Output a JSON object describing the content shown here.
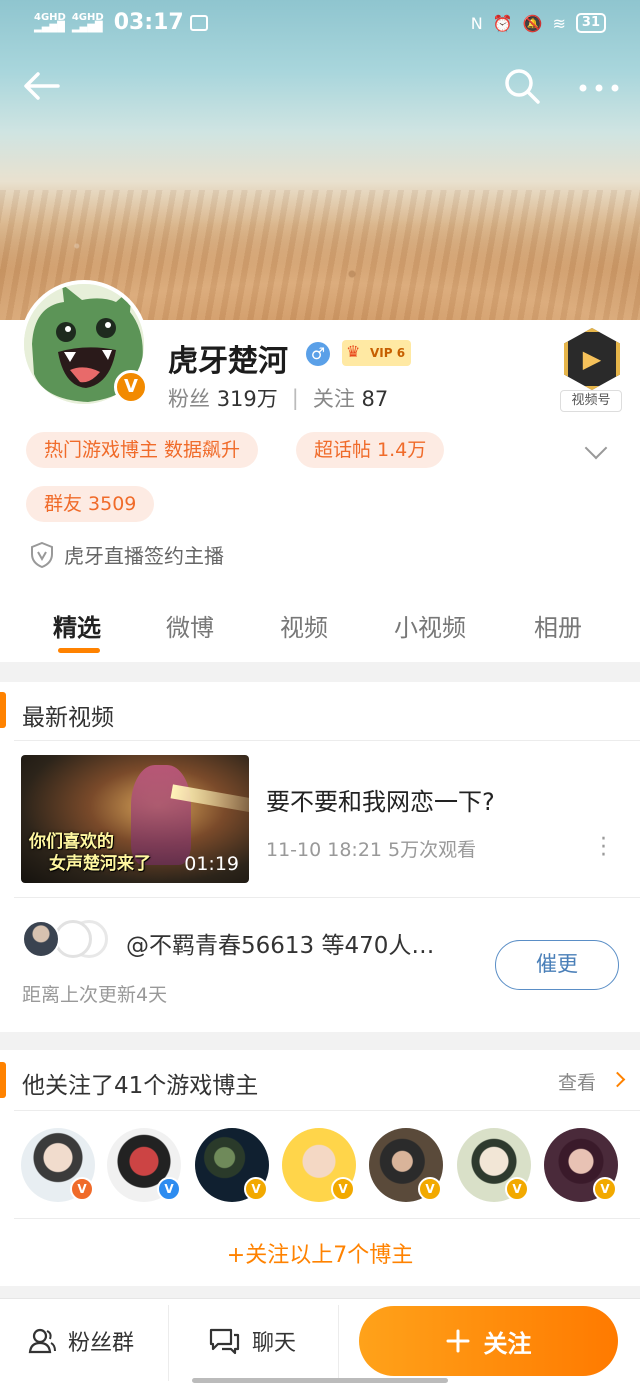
{
  "status_bar": {
    "network": "4GHD",
    "time": "03:17",
    "battery": "31"
  },
  "profile": {
    "name": "虎牙楚河",
    "gender": "♂",
    "vip": "VIP 6",
    "fans_label": "粉丝",
    "fans_count": "319万",
    "following_label": "关注",
    "following_count": "87",
    "video_badge_label": "视频号",
    "chips": [
      "热门游戏博主 数据飙升",
      "超话帖 1.4万",
      "群友 3509"
    ],
    "verification": "虎牙直播签约主播"
  },
  "tabs": [
    "精选",
    "微博",
    "视频",
    "小视频",
    "相册"
  ],
  "latest_video": {
    "section_title": "最新视频",
    "thumb_caption_1": "你们喜欢的",
    "thumb_caption_2": "女声楚河来了",
    "duration": "01:19",
    "title": "要不要和我网恋一下?",
    "meta": "11-10 18:21 5万次观看",
    "fans_urging": "@不羁青春56613 等470人…",
    "update_text": "距离上次更新4天",
    "urge_button": "催更"
  },
  "following": {
    "section_title": "他关注了41个游戏博主",
    "see_label": "查看",
    "follow_all": "+关注以上7个博主"
  },
  "bottom_bar": {
    "fan_group": "粉丝群",
    "chat": "聊天",
    "follow": "关注"
  },
  "colors": {
    "accent": "#ff8200",
    "chip_bg": "#fdebe3",
    "chip_text": "#f06b2a",
    "urge_border": "#5a8ec6"
  }
}
